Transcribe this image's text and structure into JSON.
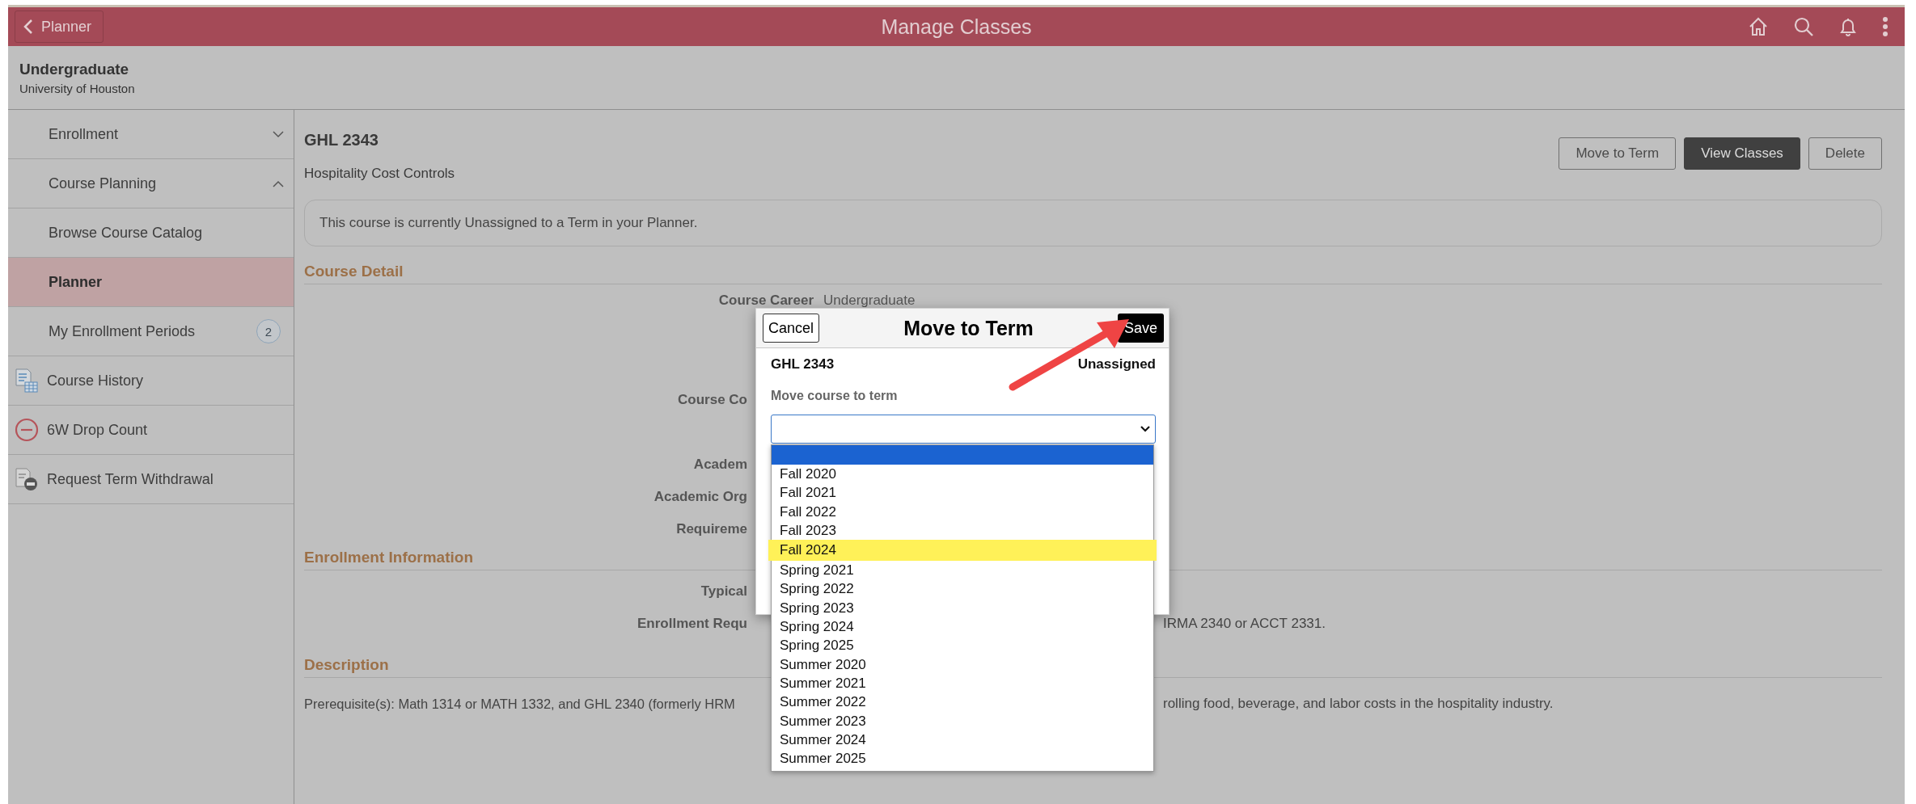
{
  "header": {
    "back_button": "Planner",
    "title": "Manage Classes"
  },
  "context": {
    "title": "Undergraduate",
    "subtitle": "University of Houston"
  },
  "sidebar": {
    "items": [
      {
        "kind": "section",
        "label": "Enrollment",
        "expanded": false,
        "selected": false
      },
      {
        "kind": "section",
        "label": "Course Planning",
        "expanded": true,
        "selected": false
      },
      {
        "kind": "link",
        "label": "Browse Course Catalog",
        "selected": false
      },
      {
        "kind": "link",
        "label": "Planner",
        "selected": true
      },
      {
        "kind": "link",
        "label": "My Enrollment Periods",
        "badge": "2",
        "selected": false
      },
      {
        "kind": "tool",
        "label": "Course History",
        "selected": false
      },
      {
        "kind": "tool",
        "label": "6W Drop Count",
        "selected": false
      },
      {
        "kind": "tool",
        "label": "Request Term Withdrawal",
        "selected": false
      }
    ]
  },
  "course": {
    "code": "GHL 2343",
    "name": "Hospitality Cost Controls",
    "buttons": [
      {
        "label": "Move to Term",
        "primary": false
      },
      {
        "label": "View Classes",
        "primary": true
      },
      {
        "label": "Delete",
        "primary": false
      }
    ],
    "notice": "This course is currently Unassigned to a Term in your Planner.",
    "sections": [
      {
        "title": "Course Detail",
        "rows": [
          {
            "kind": "full",
            "label": "Course Career",
            "value": "Undergraduate"
          },
          {
            "kind": "spacer"
          },
          {
            "kind": "cut",
            "label": "Course Co"
          },
          {
            "kind": "spacer"
          },
          {
            "kind": "cut",
            "label": "Academ"
          },
          {
            "kind": "cut",
            "label": "Academic Org"
          },
          {
            "kind": "cut",
            "label": "Requireme"
          }
        ]
      },
      {
        "title": "Enrollment Information",
        "rows": [
          {
            "kind": "cut",
            "label": "Typical"
          },
          {
            "kind": "cut",
            "label": "Enrollment Requ",
            "value": "IRMA 2340 or ACCT 2331."
          }
        ]
      },
      {
        "title": "Description",
        "rows": [
          {
            "kind": "text",
            "left": "Prerequisite(s): Math 1314 or MATH 1332, and GHL 2340 (formerly HRM",
            "right": "rolling food, beverage, and labor costs in the hospitality industry."
          }
        ]
      }
    ]
  },
  "modal": {
    "cancel": "Cancel",
    "title": "Move to Term",
    "save": "Save",
    "course_code": "GHL 2343",
    "status": "Unassigned",
    "field_label": "Move course to term",
    "options": [
      {
        "selected": true,
        "highlighted": false
      },
      {
        "label": "Fall 2020",
        "selected": false,
        "highlighted": false
      },
      {
        "label": "Fall 2021",
        "selected": false,
        "highlighted": false
      },
      {
        "label": "Fall 2022",
        "selected": false,
        "highlighted": false
      },
      {
        "label": "Fall 2023",
        "selected": false,
        "highlighted": false
      },
      {
        "label": "Fall 2024",
        "selected": false,
        "highlighted": true
      },
      {
        "label": "Spring 2021",
        "selected": false,
        "highlighted": false
      },
      {
        "label": "Spring 2022",
        "selected": false,
        "highlighted": false
      },
      {
        "label": "Spring 2023",
        "selected": false,
        "highlighted": false
      },
      {
        "label": "Spring 2024",
        "selected": false,
        "highlighted": false
      },
      {
        "label": "Spring 2025",
        "selected": false,
        "highlighted": false
      },
      {
        "label": "Summer 2020",
        "selected": false,
        "highlighted": false
      },
      {
        "label": "Summer 2021",
        "selected": false,
        "highlighted": false
      },
      {
        "label": "Summer 2022",
        "selected": false,
        "highlighted": false
      },
      {
        "label": "Summer 2023",
        "selected": false,
        "highlighted": false
      },
      {
        "label": "Summer 2024",
        "selected": false,
        "highlighted": false
      },
      {
        "label": "Summer 2025",
        "selected": false,
        "highlighted": false
      }
    ]
  }
}
